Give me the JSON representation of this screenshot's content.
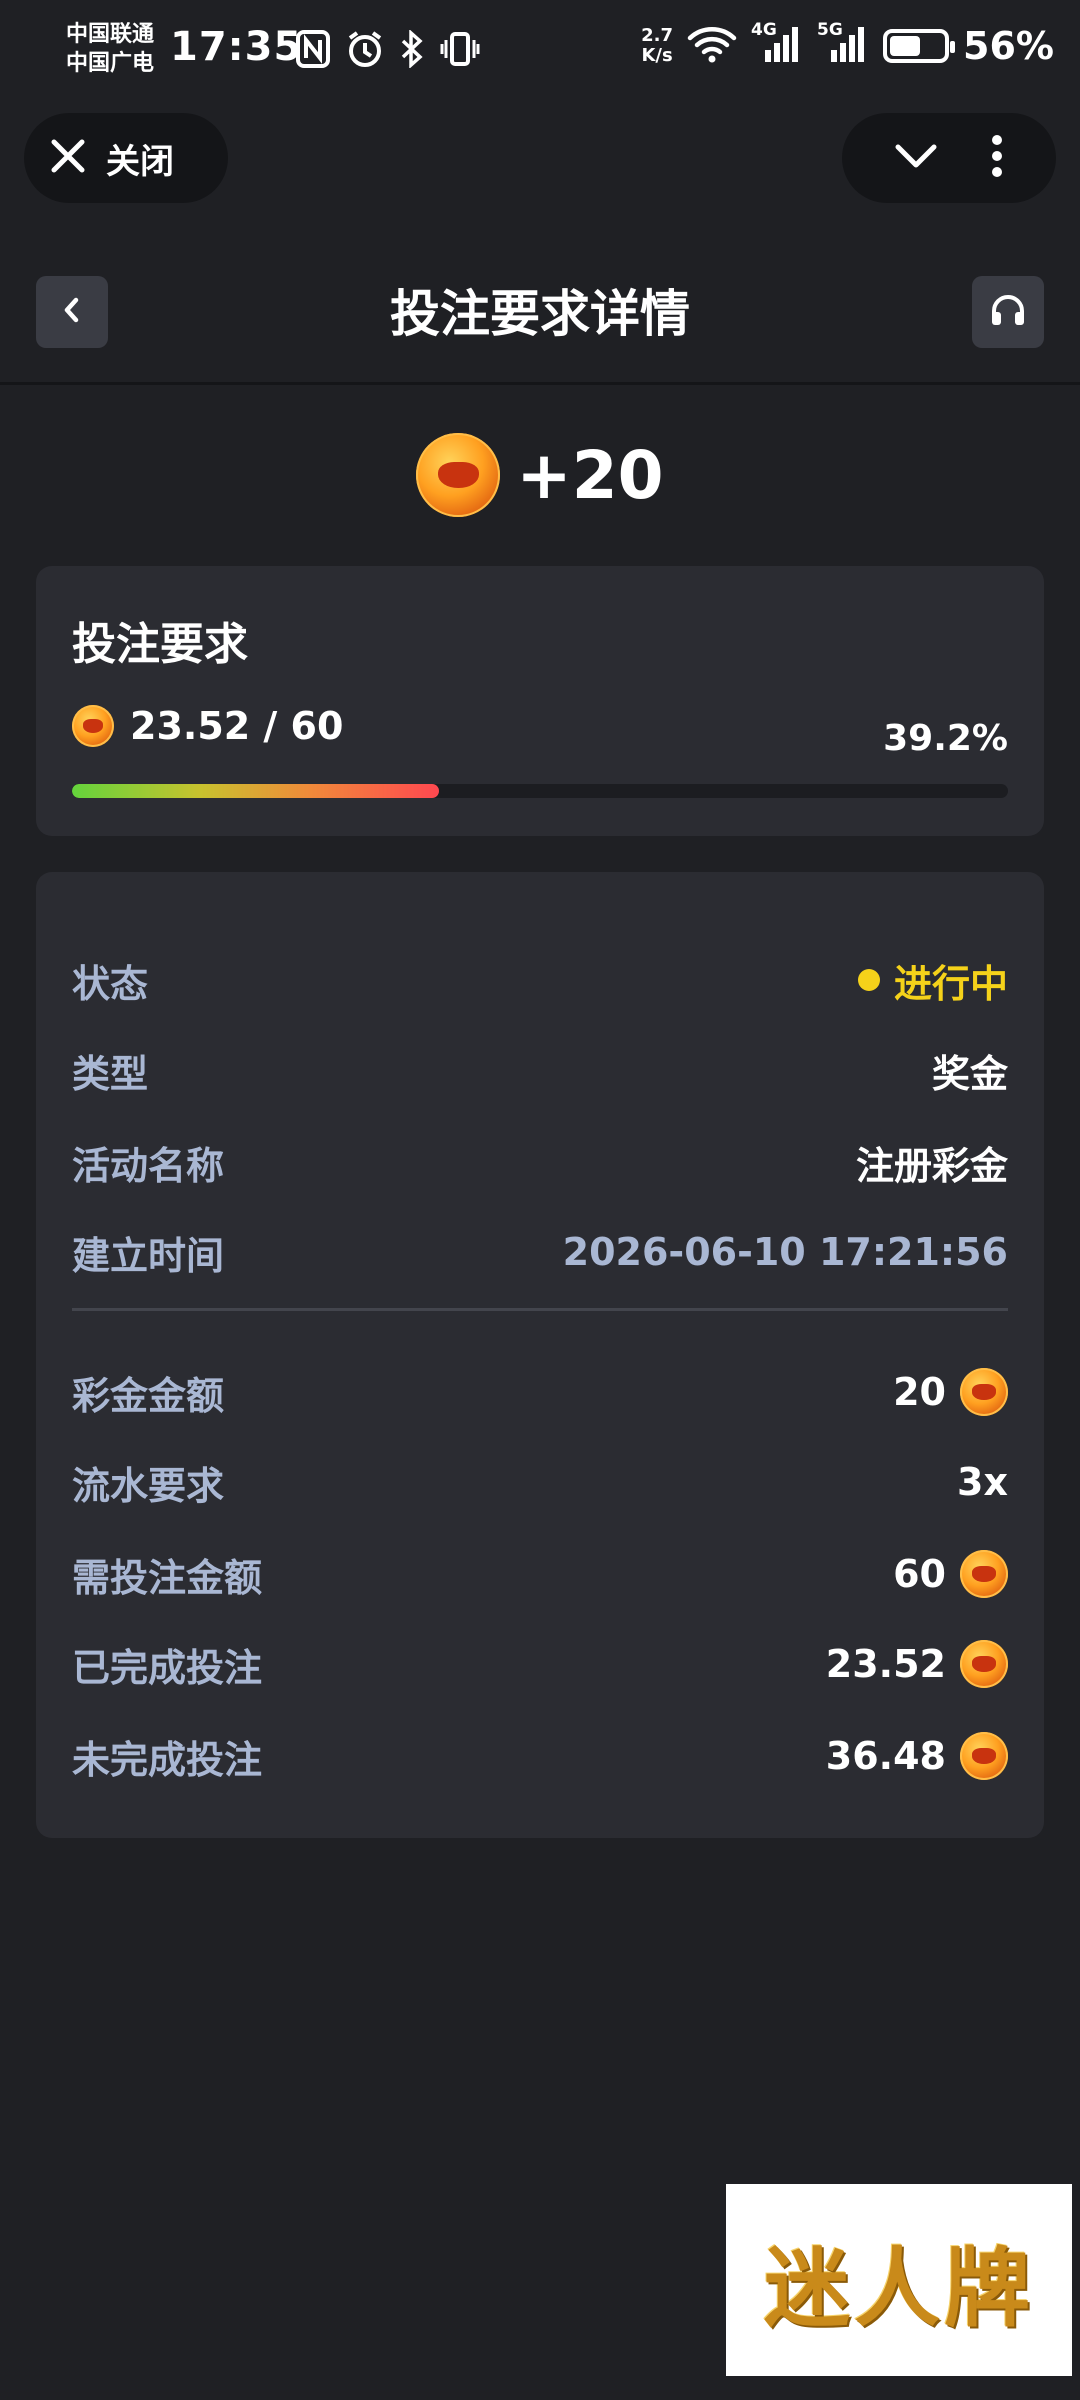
{
  "status_bar": {
    "carrier_1": "中国联通",
    "carrier_2": "中国广电",
    "time": "17:35",
    "net_speed_value": "2.7",
    "net_speed_unit": "K/s",
    "sig1_label": "4G",
    "sig2_label": "5G",
    "battery_pct": "56%"
  },
  "browser_bar": {
    "close_label": "关闭"
  },
  "header": {
    "title": "投注要求详情"
  },
  "bonus": {
    "amount": "+20"
  },
  "requirement": {
    "title": "投注要求",
    "progress_text": "23.52 / 60",
    "percent": "39.2%",
    "progress_fraction": 0.392
  },
  "details": {
    "status": {
      "label": "状态",
      "value": "进行中"
    },
    "type": {
      "label": "类型",
      "value": "奖金"
    },
    "activity": {
      "label": "活动名称",
      "value": "注册彩金"
    },
    "created": {
      "label": "建立时间",
      "value": "2026-06-10 17:21:56"
    },
    "bonus_amount": {
      "label": "彩金金额",
      "value": "20"
    },
    "turnover": {
      "label": "流水要求",
      "value": "3x"
    },
    "required_bet": {
      "label": "需投注金额",
      "value": "60"
    },
    "completed_bet": {
      "label": "已完成投注",
      "value": "23.52"
    },
    "remaining_bet": {
      "label": "未完成投注",
      "value": "36.48"
    }
  },
  "watermark": {
    "text": "迷人牌"
  },
  "colors": {
    "background": "#1f2024",
    "card": "#2b2c32",
    "label": "#a9b7d3",
    "status_yellow": "#f5d21a"
  }
}
